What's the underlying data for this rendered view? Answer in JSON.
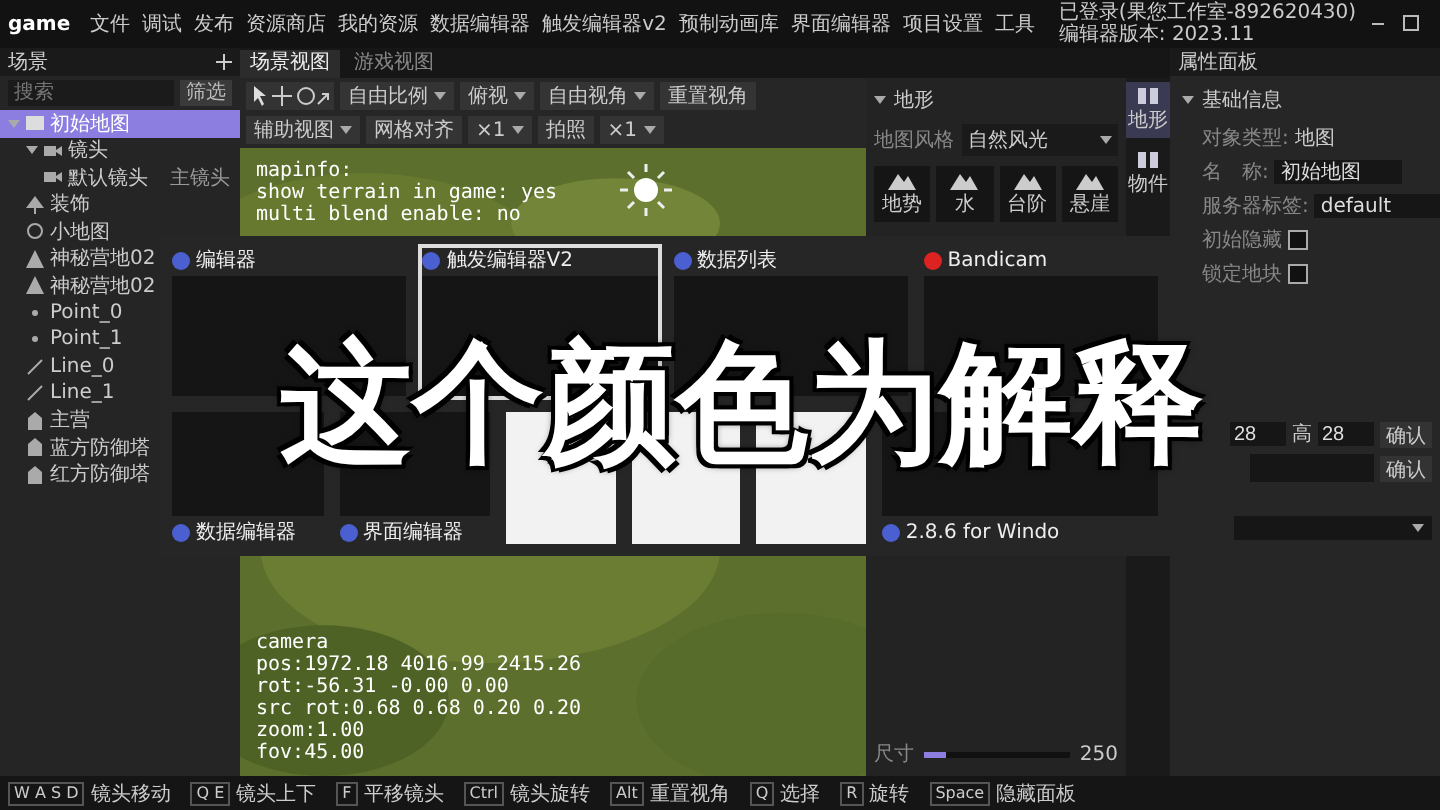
{
  "window": {
    "app_name": "game",
    "menu": [
      "文件",
      "调试",
      "发布",
      "资源商店",
      "我的资源",
      "数据编辑器",
      "触发编辑器v2",
      "预制动画库",
      "界面编辑器",
      "项目设置",
      "工具"
    ],
    "login": "已登录(果您工作室-892620430)",
    "version": "编辑器版本: 2023.11"
  },
  "scene_panel": {
    "title": "场景",
    "search": {
      "placeholder": "搜索"
    },
    "filter_button": "筛选",
    "tree": [
      {
        "label": "初始地图",
        "kind": "map",
        "selected": true,
        "expanded": true,
        "children": [
          {
            "label": "镜头",
            "kind": "camera",
            "selected": false,
            "expanded": true,
            "children": [
              {
                "label": "默认镜头",
                "kind": "camera",
                "selected": false,
                "tag": "主镜头"
              }
            ]
          },
          {
            "label": "装饰",
            "kind": "decor",
            "selected": false
          },
          {
            "label": "小地图",
            "kind": "minimap",
            "selected": false
          },
          {
            "label": "神秘营地02",
            "kind": "camp",
            "selected": false
          },
          {
            "label": "神秘营地02",
            "kind": "camp",
            "selected": false
          },
          {
            "label": "Point_0",
            "kind": "point",
            "selected": false
          },
          {
            "label": "Point_1",
            "kind": "point",
            "selected": false
          },
          {
            "label": "Line_0",
            "kind": "line",
            "selected": false
          },
          {
            "label": "Line_1",
            "kind": "line",
            "selected": false
          },
          {
            "label": "主营",
            "kind": "building",
            "selected": false
          },
          {
            "label": "蓝方防御塔",
            "kind": "building",
            "selected": false
          },
          {
            "label": "红方防御塔",
            "kind": "building",
            "selected": false
          }
        ]
      }
    ]
  },
  "view_tabs": [
    {
      "label": "场景视图",
      "selected": true
    },
    {
      "label": "游戏视图",
      "selected": false
    }
  ],
  "toolbar": [
    {
      "label": "自由比例",
      "dropdown": true
    },
    {
      "label": "俯视",
      "dropdown": true
    },
    {
      "label": "自由视角",
      "dropdown": true
    },
    {
      "label": "重置视角",
      "dropdown": false
    },
    {
      "label": "辅助视图",
      "dropdown": true
    },
    {
      "label": "网格对齐",
      "dropdown": false
    },
    {
      "label": "×1",
      "dropdown": true
    },
    {
      "label": "拍照",
      "dropdown": false
    },
    {
      "label": "×1",
      "dropdown": true
    }
  ],
  "viewport": {
    "map_info": [
      "mapinfo:",
      "show terrain in game: yes",
      "multi blend enable: no"
    ],
    "camera_info": [
      "camera",
      "pos:1972.18 4016.99 2415.26",
      "rot:-56.31 -0.00 0.00",
      "src rot:0.68 0.68 0.20 0.20",
      "zoom:1.00",
      "fov:45.00"
    ]
  },
  "terrain_panel": {
    "title": "地形",
    "style_label": "地图风格",
    "style_value": "自然风光",
    "tools": [
      "地势",
      "水",
      "台阶",
      "悬崖"
    ],
    "size_label": "尺寸",
    "size": {
      "level": 0.15
    },
    "size_value": "250"
  },
  "side_strip": [
    {
      "label": "地形",
      "selected": true
    },
    {
      "label": "物件",
      "selected": false
    }
  ],
  "properties": {
    "title": "属性面板",
    "section": "基础信息",
    "type_label": "对象类型:",
    "type_value": "地图",
    "name_label": "名　称:",
    "name_value": "初始地图",
    "tag_label": "服务器标签:",
    "tag_value": "default",
    "checks": [
      {
        "label": "初始隐藏",
        "checked": false
      },
      {
        "label": "锁定地块",
        "checked": false
      }
    ],
    "width_value": "28",
    "height_label": "高",
    "height_value": "28",
    "confirm": [
      "确认",
      "确认"
    ]
  },
  "switcher": {
    "windows": [
      {
        "title": "编辑器",
        "selected": false
      },
      {
        "title": "触发编辑器V2",
        "selected": true
      },
      {
        "title": "数据列表",
        "selected": false
      },
      {
        "title": "Bandicam",
        "selected": false
      },
      {
        "title": "数据编辑器",
        "selected": false
      },
      {
        "title": "界面编辑器",
        "selected": false
      },
      {
        "selected": false
      },
      {
        "selected": false
      },
      {
        "selected": false
      },
      {
        "title": "2.8.6 for Windo",
        "selected": false
      }
    ],
    "caption": "这个颜色为解释"
  },
  "status_bar": [
    {
      "key": "W A S D",
      "label": "镜头移动"
    },
    {
      "key": "Q E",
      "label": "镜头上下"
    },
    {
      "key": "F",
      "label": "平移镜头"
    },
    {
      "key": "Ctrl",
      "label": "镜头旋转"
    },
    {
      "key": "Alt",
      "label": "重置视角"
    },
    {
      "key": "Q",
      "label": "选择"
    },
    {
      "key": "R",
      "label": "旋转"
    },
    {
      "key": "Space",
      "label": "隐藏面板"
    }
  ]
}
